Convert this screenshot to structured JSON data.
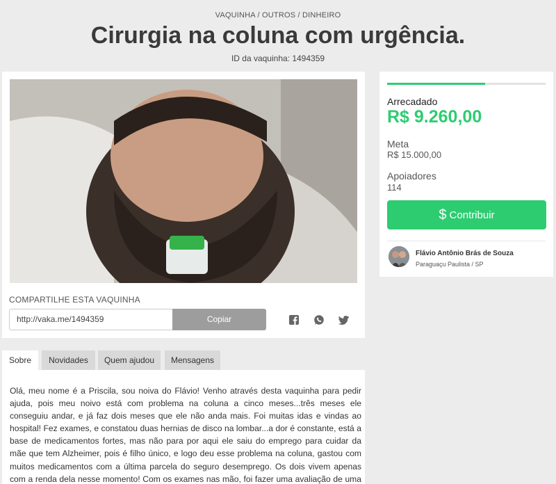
{
  "breadcrumb": "VAQUINHA / OUTROS / DINHEIRO",
  "title": "Cirurgia na coluna com urgência.",
  "campaign_id": "ID da vaquinha: 1494359",
  "photo": {
    "icon": "patient-photo"
  },
  "share": {
    "label": "COMPARTILHE ESTA VAQUINHA",
    "link": "http://vaka.me/1494359",
    "copy_label": "Copiar",
    "icons": [
      "facebook-icon",
      "whatsapp-icon",
      "twitter-icon"
    ]
  },
  "stats": {
    "progress_fraction": 0.617,
    "raised_label": "Arrecadado",
    "raised_value": "R$ 9.260,00",
    "goal_label": "Meta",
    "goal_value": "R$ 15.000,00",
    "supporters_label": "Apoiadores",
    "supporters_value": "114",
    "contribute_label": "Contribuir",
    "contribute_icon": "$"
  },
  "owner": {
    "name": "Flávio Antônio Brás de Souza",
    "location": "Paraguaçu Paulista / SP"
  },
  "tabs": [
    {
      "label": "Sobre",
      "active": true
    },
    {
      "label": "Novidades",
      "active": false
    },
    {
      "label": "Quem ajudou",
      "active": false
    },
    {
      "label": "Mensagens",
      "active": false
    }
  ],
  "story": "Olá, meu nome é a Priscila, sou noiva do Flávio! Venho através desta vaquinha para pedir ajuda, pois meu noivo está com problema na coluna a cinco meses...três meses ele conseguiu andar, e já faz dois meses que ele não anda mais. Foi muitas idas e vindas ao hospital! Fez exames, e constatou duas hernias de disco na lombar...a dor é constante, está a base de medicamentos fortes, mas não para por aqui ele saiu do emprego para cuidar da mãe que tem Alzheimer, pois é filho único, e logo deu esse problema na coluna, gastou com muitos medicamentos com a última parcela do seguro desemprego. Os dois vivem apenas com a renda dela nesse momento! Com os exames nas mão, foi fazer uma avaliação de uma possibilidade de fazer bloqueio, pois ficaria em torno de cinco mil reais iríamos",
  "colors": {
    "accent": "#2ecc71",
    "copy_button": "#9d9d9d",
    "tab_inactive": "#d9d9d9"
  }
}
